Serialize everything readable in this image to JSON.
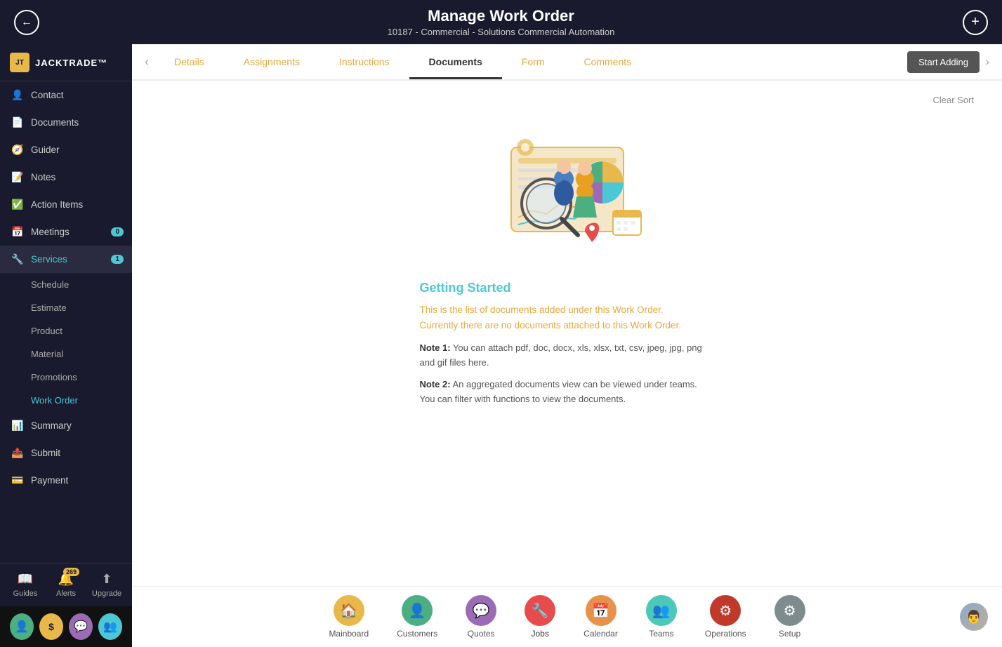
{
  "header": {
    "title": "Manage Work Order",
    "subtitle": "10187 - Commercial - Solutions Commercial Automation",
    "back_label": "←",
    "add_label": "+"
  },
  "tabs": {
    "items": [
      {
        "label": "Details",
        "active": false
      },
      {
        "label": "Assignments",
        "active": false
      },
      {
        "label": "Instructions",
        "active": false
      },
      {
        "label": "Documents",
        "active": true
      },
      {
        "label": "Form",
        "active": false
      },
      {
        "label": "Comments",
        "active": false
      }
    ],
    "start_adding_label": "Start Adding"
  },
  "sidebar": {
    "logo_text": "JACKTRADE™",
    "items": [
      {
        "label": "Contact",
        "icon": "👤",
        "active": false
      },
      {
        "label": "Documents",
        "icon": "📄",
        "active": false
      },
      {
        "label": "Guider",
        "icon": "🧭",
        "active": false
      },
      {
        "label": "Notes",
        "icon": "📝",
        "active": false
      },
      {
        "label": "Action Items",
        "icon": "✅",
        "active": false
      },
      {
        "label": "Meetings",
        "icon": "📅",
        "badge": "0",
        "active": false
      },
      {
        "label": "Services",
        "icon": "🔧",
        "badge": "1",
        "active": true,
        "teal": true
      }
    ],
    "sub_items": [
      {
        "label": "Schedule"
      },
      {
        "label": "Estimate"
      },
      {
        "label": "Product"
      },
      {
        "label": "Material"
      },
      {
        "label": "Promotions"
      },
      {
        "label": "Work Order",
        "active": true
      }
    ],
    "bottom_items": [
      {
        "label": "Summary"
      },
      {
        "label": "Submit"
      },
      {
        "label": "Payment"
      }
    ],
    "bottom_actions": [
      {
        "label": "Guides",
        "icon": "📖"
      },
      {
        "label": "Alerts",
        "icon": "🔔",
        "badge": "269"
      },
      {
        "label": "Upgrade",
        "icon": "⬆"
      }
    ],
    "user_icons": [
      {
        "icon": "👤",
        "color": "#4caf82"
      },
      {
        "icon": "$",
        "color": "#e8b84b"
      },
      {
        "icon": "💬",
        "color": "#9c6bb5"
      },
      {
        "icon": "👥",
        "color": "#4bc8d4"
      }
    ]
  },
  "content": {
    "clear_sort_label": "Clear Sort",
    "getting_started_title": "Getting Started",
    "getting_started_text": "This is the list of documents added under this Work Order.\nCurrently there are no documents attached to this Work Order.",
    "note1_label": "Note 1:",
    "note1_text": "You can attach pdf, doc, docx, xls, xlsx, txt, csv, jpeg, jpg, png and gif files here.",
    "note2_label": "Note 2:",
    "note2_text": "An aggregated documents view can be viewed under teams. You can filter with functions to view the documents."
  },
  "bottom_nav": {
    "items": [
      {
        "label": "Mainboard",
        "icon": "🏠",
        "color": "nav-icon-yellow"
      },
      {
        "label": "Customers",
        "icon": "👤",
        "color": "nav-icon-green"
      },
      {
        "label": "Quotes",
        "icon": "💬",
        "color": "nav-icon-purple"
      },
      {
        "label": "Jobs",
        "icon": "🔧",
        "color": "nav-icon-red",
        "active": true
      },
      {
        "label": "Calendar",
        "icon": "📅",
        "color": "nav-icon-orange"
      },
      {
        "label": "Teams",
        "icon": "👥",
        "color": "nav-icon-teal"
      },
      {
        "label": "Operations",
        "icon": "⚙",
        "color": "nav-icon-darkred"
      },
      {
        "label": "Setup",
        "icon": "⚙",
        "color": "nav-icon-gray"
      }
    ]
  }
}
